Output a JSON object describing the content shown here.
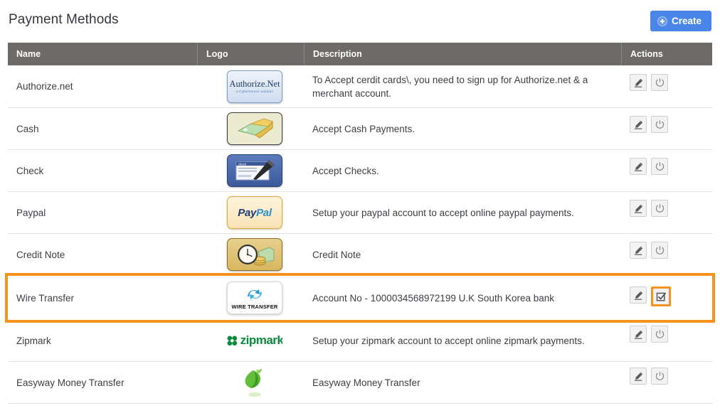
{
  "header": {
    "title": "Payment Methods",
    "create_label": "Create",
    "create_icon": "plus-circle-icon",
    "accent_color": "#4a86e8"
  },
  "table": {
    "columns": [
      {
        "key": "name",
        "label": "Name"
      },
      {
        "key": "logo",
        "label": "Logo"
      },
      {
        "key": "description",
        "label": "Description"
      },
      {
        "key": "actions",
        "label": "Actions"
      }
    ],
    "header_bg": "#6d6a67",
    "highlight_color": "#f6921e",
    "rows": [
      {
        "name": "Authorize.net",
        "logo": {
          "type": "authorize",
          "text": "Authorize.Net",
          "subtext": "a CyberSource solution"
        },
        "description": "To Accept cerdit cards\\, you need to sign up for Authorize.net & a merchant account.",
        "actions": [
          {
            "icon": "pencil-edit-icon",
            "label": "Edit",
            "state": "normal"
          },
          {
            "icon": "power-toggle-icon",
            "label": "Toggle status",
            "state": "normal"
          }
        ],
        "highlighted": false
      },
      {
        "name": "Cash",
        "logo": {
          "type": "cash",
          "text": "",
          "subtext": ""
        },
        "description": "Accept Cash Payments.",
        "actions": [
          {
            "icon": "pencil-edit-icon",
            "label": "Edit",
            "state": "normal"
          },
          {
            "icon": "power-toggle-icon",
            "label": "Toggle status",
            "state": "normal"
          }
        ],
        "highlighted": false
      },
      {
        "name": "Check",
        "logo": {
          "type": "check",
          "text": "check",
          "subtext": ""
        },
        "description": "Accept Checks.",
        "actions": [
          {
            "icon": "pencil-edit-icon",
            "label": "Edit",
            "state": "normal"
          },
          {
            "icon": "power-toggle-icon",
            "label": "Toggle status",
            "state": "normal"
          }
        ],
        "highlighted": false
      },
      {
        "name": "Paypal",
        "logo": {
          "type": "paypal",
          "text": "PayPal",
          "subtext": ""
        },
        "description": "Setup your paypal account to accept online paypal payments.",
        "actions": [
          {
            "icon": "pencil-edit-icon",
            "label": "Edit",
            "state": "normal"
          },
          {
            "icon": "power-toggle-icon",
            "label": "Toggle status",
            "state": "normal"
          }
        ],
        "highlighted": false
      },
      {
        "name": "Credit Note",
        "logo": {
          "type": "creditnote",
          "text": "",
          "subtext": ""
        },
        "description": "Credit Note",
        "actions": [
          {
            "icon": "pencil-edit-icon",
            "label": "Edit",
            "state": "normal"
          },
          {
            "icon": "power-toggle-icon",
            "label": "Toggle status",
            "state": "normal"
          }
        ],
        "highlighted": false
      },
      {
        "name": "Wire Transfer",
        "logo": {
          "type": "wire",
          "text": "WIRE TRANSFER",
          "subtext": ""
        },
        "description": "Account No - 1000034568972199 U.K South Korea bank",
        "actions": [
          {
            "icon": "pencil-edit-icon",
            "label": "Edit",
            "state": "normal"
          },
          {
            "icon": "checkbox-checked-icon",
            "label": "Enable",
            "state": "highlighted"
          }
        ],
        "highlighted": true
      },
      {
        "name": "Zipmark",
        "logo": {
          "type": "zipmark",
          "text": "zipmark",
          "subtext": ""
        },
        "description": "Setup your zipmark account to accept online zipmark payments.",
        "actions": [
          {
            "icon": "pencil-edit-icon",
            "label": "Edit",
            "state": "normal"
          },
          {
            "icon": "power-toggle-icon",
            "label": "Toggle status",
            "state": "normal"
          }
        ],
        "highlighted": false
      },
      {
        "name": "Easyway Money Transfer",
        "logo": {
          "type": "easyway",
          "text": "",
          "subtext": ""
        },
        "description": "Easyway Money Transfer",
        "actions": [
          {
            "icon": "pencil-edit-icon",
            "label": "Edit",
            "state": "normal"
          },
          {
            "icon": "power-toggle-icon",
            "label": "Toggle status",
            "state": "normal"
          }
        ],
        "highlighted": false
      }
    ]
  }
}
